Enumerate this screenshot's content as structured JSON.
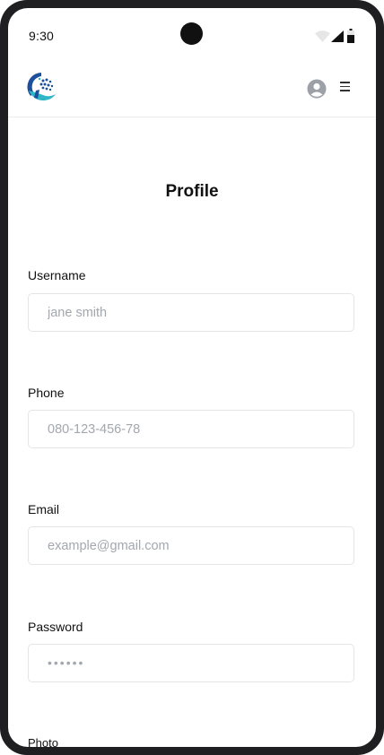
{
  "status_bar": {
    "time": "9:30"
  },
  "header": {
    "logo_icon": "brand-logo-icon",
    "account_icon": "user-circle-icon",
    "menu_icon": "hamburger-menu-icon"
  },
  "page": {
    "title": "Profile"
  },
  "form": {
    "username": {
      "label": "Username",
      "placeholder": "jane smith",
      "value": ""
    },
    "phone": {
      "label": "Phone",
      "placeholder": "080-123-456-78",
      "value": ""
    },
    "email": {
      "label": "Email",
      "placeholder": "example@gmail.com",
      "value": ""
    },
    "password": {
      "label": "Password",
      "placeholder": "••••••",
      "value": ""
    },
    "photo": {
      "label": "Photo"
    }
  },
  "colors": {
    "frame": "#1f1f21",
    "input_border": "#e3e5e8",
    "placeholder": "#a3a7ae",
    "logo_blue": "#1c4f9c",
    "logo_teal": "#2fb7c6"
  }
}
